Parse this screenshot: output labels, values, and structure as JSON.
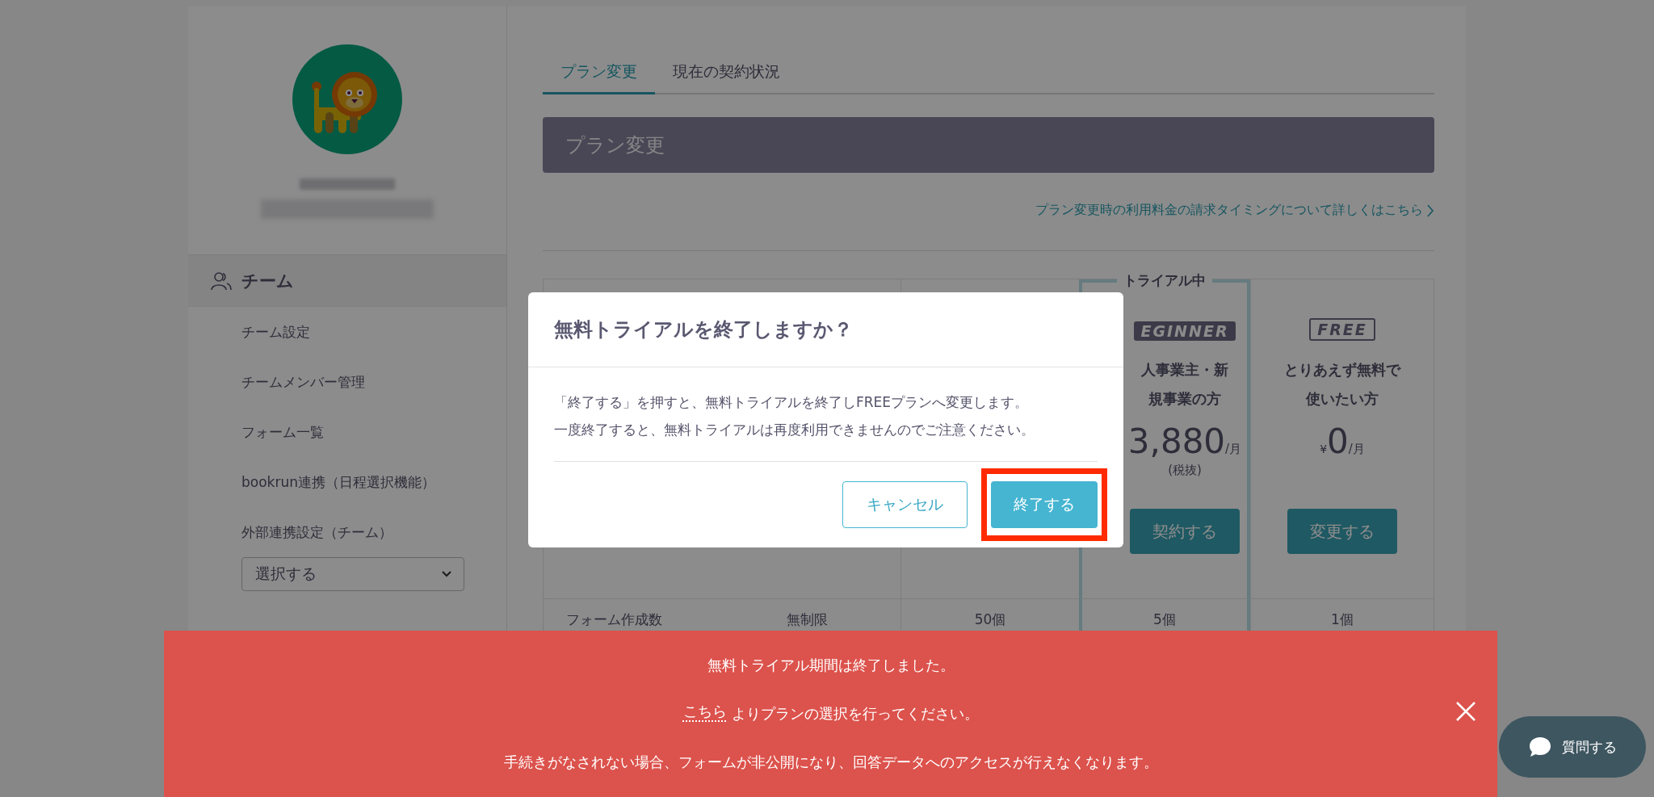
{
  "sidebar": {
    "team_heading": "チーム",
    "items": [
      "チーム設定",
      "チームメンバー管理",
      "フォーム一覧",
      "bookrun連携（日程選択機能）",
      "外部連携設定（チーム）"
    ],
    "select": {
      "value": "選択する"
    }
  },
  "tabs": [
    {
      "label": "プラン変更",
      "selected": true
    },
    {
      "label": "現在の契約状況",
      "selected": false
    }
  ],
  "section_title": "プラン変更",
  "billing_link": "プラン変更時の利用料金の請求タイミングについて詳しくはこちら",
  "plans": [
    {
      "status_label": "トライアル中",
      "badge": "EGINNER",
      "kind": "filled",
      "audience": [
        "人事業主・新",
        "規事業の方"
      ],
      "price": "3,880",
      "unit": "/月",
      "tax_note": "(税抜)",
      "button": "契約する",
      "highlighted": true
    },
    {
      "badge": "FREE",
      "kind": "outline",
      "audience": [
        "とりあえず無料で",
        "使いたい方"
      ],
      "price_prefix": "¥",
      "price": "0",
      "unit": "/月",
      "button": "変更する",
      "highlighted": false
    }
  ],
  "feature_rows": [
    {
      "label": "フォーム作成数",
      "values": [
        "無制限",
        "50個",
        "5個",
        "1個"
      ]
    }
  ],
  "modal": {
    "title": "無料トライアルを終了しますか？",
    "body": [
      "「終了する」を押すと、無料トライアルを終了しFREEプランへ変更します。",
      "一度終了すると、無料トライアルは再度利用できませんのでご注意ください。"
    ],
    "buttons": [
      {
        "label": "キャンセル",
        "kind": "secondary",
        "highlighted": false
      },
      {
        "label": "終了する",
        "kind": "primary",
        "highlighted": true
      }
    ]
  },
  "banner": {
    "title": "無料トライアル期間は終了しました。",
    "link": "こちら",
    "link_text": "よりプランの選択を行ってください。",
    "warning": "手続きがなされない場合、フォームが非公開になり、回答データへのアクセスが行えなくなります。"
  },
  "chat_button": "質問する"
}
